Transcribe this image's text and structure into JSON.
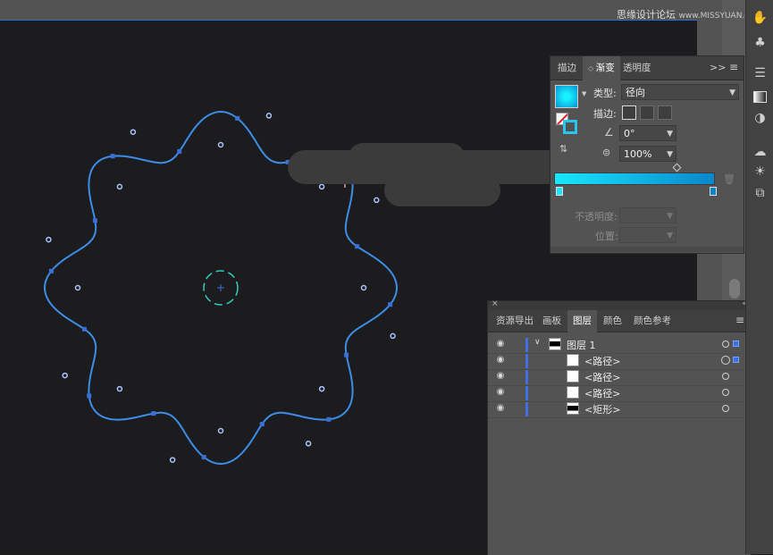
{
  "watermark": {
    "text": "思缘设计论坛",
    "url_text": "www.MISSYUAN.COM"
  },
  "colors": {
    "path_blue": "#3b8ee8",
    "anchor": "#3b6fd6",
    "handle_point": "#a9c6ff",
    "canvas": "#1c1c1e",
    "panel": "#535353",
    "gradient_start": "#19e6ff",
    "gradient_end": "#0a86cc",
    "layer_color": "#3f6fe0",
    "center_shape": "#2fd0c0"
  },
  "gradient_panel": {
    "tabs": [
      "描边",
      "渐变",
      "透明度"
    ],
    "active_tab_index": 1,
    "type_label": "类型:",
    "type_value": "径向",
    "stroke_label": "描边:",
    "angle_value": "0°",
    "aspect_value": "100%",
    "opacity_label": "不透明度:",
    "location_label": "位置:",
    "more_icon": "double-chevron-right-icon",
    "menu_icon": "hamburger-icon"
  },
  "layers_panel": {
    "tabs": [
      "资源导出",
      "画板",
      "图层",
      "颜色",
      "颜色参考"
    ],
    "active_tab_index": 2,
    "rows": [
      {
        "name": "图层 1",
        "kind": "layer"
      },
      {
        "name": "<路径>",
        "kind": "path"
      },
      {
        "name": "<路径>",
        "kind": "path"
      },
      {
        "name": "<路径>",
        "kind": "path"
      },
      {
        "name": "<矩形>",
        "kind": "rect"
      }
    ]
  },
  "tool_strip": {
    "icons": [
      "hand-brush-icon",
      "club-icon",
      "align-icon",
      "gradient-swatch-icon",
      "transparency-icon",
      "creative-cloud-icon",
      "sun-icon",
      "export-icon"
    ]
  }
}
